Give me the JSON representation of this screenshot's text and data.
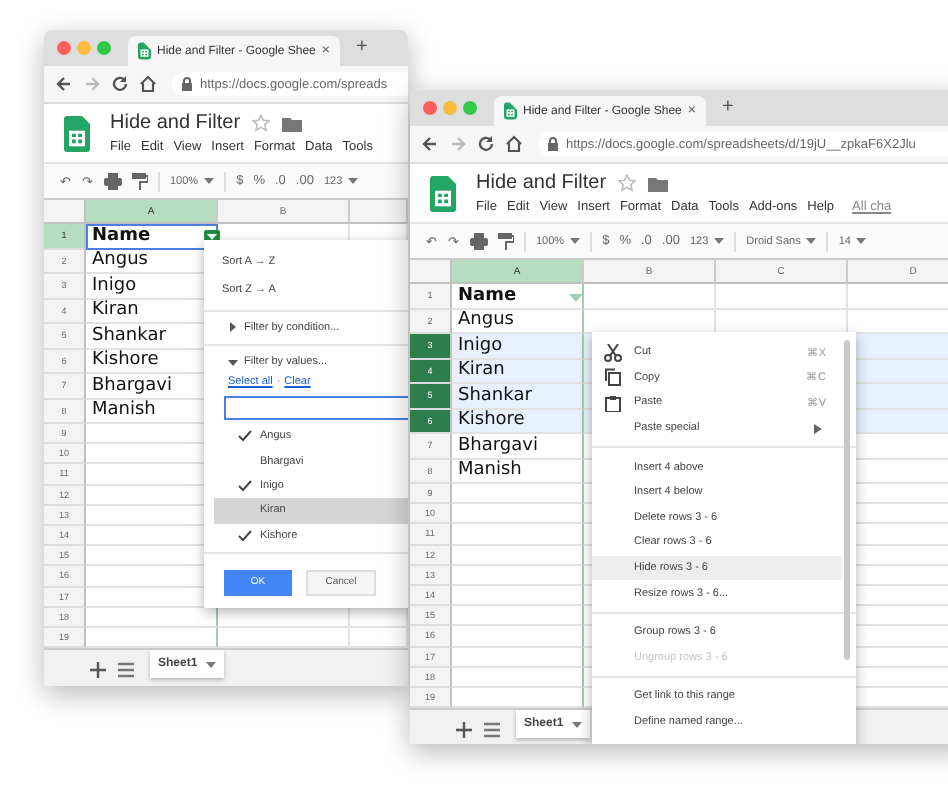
{
  "windows": [
    {
      "browser_tab": "Hide and Filter - Google Shee",
      "tab_close": "×",
      "new_tab": "+",
      "url": "https://docs.google.com/spreads",
      "doc_title": "Hide and Filter",
      "menus": [
        {
          "kind": "menu",
          "label": "File"
        },
        {
          "kind": "menu",
          "label": "Edit"
        },
        {
          "kind": "menu",
          "label": "View"
        },
        {
          "kind": "menu",
          "label": "Insert"
        },
        {
          "kind": "menu",
          "label": "Format"
        },
        {
          "kind": "menu",
          "label": "Data"
        },
        {
          "kind": "menu",
          "label": "Tools"
        }
      ],
      "toolbar": [
        {
          "kind": "text",
          "label": "↶"
        },
        {
          "kind": "text",
          "label": "↷"
        },
        {
          "kind": "print"
        },
        {
          "kind": "paint"
        },
        {
          "kind": "divider"
        },
        {
          "kind": "dropdown",
          "label": "100%"
        },
        {
          "kind": "divider"
        },
        {
          "kind": "text",
          "label": "$"
        },
        {
          "kind": "text",
          "label": "%"
        },
        {
          "kind": "text",
          "label": ".0"
        },
        {
          "kind": "text",
          "label": ".00"
        },
        {
          "kind": "dropdown",
          "label": "123"
        }
      ],
      "columns": [
        {
          "label": "A",
          "selected": true
        },
        {
          "label": "B",
          "selected": false
        }
      ],
      "row_selection": false,
      "filter_open": true,
      "rows": [
        {
          "number": "1",
          "value": "Name",
          "selected": true
        },
        {
          "number": "2",
          "value": "Angus",
          "selected": false
        },
        {
          "number": "3",
          "value": "Inigo",
          "selected": false
        },
        {
          "number": "4",
          "value": "Kiran",
          "selected": false
        },
        {
          "number": "5",
          "value": "Shankar",
          "selected": false
        },
        {
          "number": "6",
          "value": "Kishore",
          "selected": false
        },
        {
          "number": "7",
          "value": "Bhargavi",
          "selected": false
        },
        {
          "number": "8",
          "value": "Manish",
          "selected": false
        },
        {
          "number": "9",
          "selected": false
        },
        {
          "number": "10",
          "selected": false
        },
        {
          "number": "11",
          "selected": false
        },
        {
          "number": "12",
          "selected": false
        },
        {
          "number": "13",
          "selected": false
        },
        {
          "number": "14",
          "selected": false
        },
        {
          "number": "15",
          "selected": false
        },
        {
          "number": "16",
          "selected": false
        },
        {
          "number": "17",
          "selected": false
        },
        {
          "number": "18",
          "selected": false
        },
        {
          "number": "19",
          "selected": false
        }
      ],
      "sheet_tab": "Sheet1",
      "filter_menu": {
        "sort": [
          "Sort A → Z",
          "Sort Z → A"
        ],
        "condition": {
          "label": "Filter by condition...",
          "expanded": false
        },
        "values": {
          "label": "Filter by values...",
          "expanded": true
        },
        "select_all": "Select all",
        "separator": "·",
        "clear": "Clear",
        "items": [
          {
            "label": "Angus",
            "checked": true,
            "selected": false
          },
          {
            "label": "Bhargavi",
            "checked": false,
            "selected": false
          },
          {
            "label": "Inigo",
            "checked": true,
            "selected": false
          },
          {
            "label": "Kiran",
            "checked": false,
            "selected": true
          },
          {
            "label": "Kishore",
            "checked": true,
            "selected": false
          }
        ],
        "ok": "OK",
        "cancel": "Cancel"
      }
    },
    {
      "browser_tab": "Hide and Filter - Google Shee",
      "tab_close": "×",
      "new_tab": "+",
      "url": "https://docs.google.com/spreadsheets/d/19jU__zpkaF6X2Jlu",
      "doc_title": "Hide and Filter",
      "menus": [
        {
          "kind": "menu",
          "label": "File"
        },
        {
          "kind": "menu",
          "label": "Edit"
        },
        {
          "kind": "menu",
          "label": "View"
        },
        {
          "kind": "menu",
          "label": "Insert"
        },
        {
          "kind": "menu",
          "label": "Format"
        },
        {
          "kind": "menu",
          "label": "Data"
        },
        {
          "kind": "menu",
          "label": "Tools"
        },
        {
          "kind": "menu",
          "label": "Add-ons"
        },
        {
          "kind": "menu",
          "label": "Help"
        },
        {
          "kind": "link",
          "label": "All cha"
        }
      ],
      "toolbar": [
        {
          "kind": "text",
          "label": "↶"
        },
        {
          "kind": "text",
          "label": "↷"
        },
        {
          "kind": "print"
        },
        {
          "kind": "paint"
        },
        {
          "kind": "divider"
        },
        {
          "kind": "dropdown",
          "label": "100%"
        },
        {
          "kind": "divider"
        },
        {
          "kind": "text",
          "label": "$"
        },
        {
          "kind": "text",
          "label": "%"
        },
        {
          "kind": "text",
          "label": ".0"
        },
        {
          "kind": "text",
          "label": ".00"
        },
        {
          "kind": "dropdown",
          "label": "123"
        },
        {
          "kind": "divider"
        },
        {
          "kind": "dropdown",
          "label": "Droid Sans"
        },
        {
          "kind": "divider"
        },
        {
          "kind": "dropdown",
          "label": "14"
        }
      ],
      "columns": [
        {
          "label": "A",
          "selected": true
        },
        {
          "label": "B",
          "selected": false
        },
        {
          "label": "C",
          "selected": false
        },
        {
          "label": "D",
          "selected": false
        }
      ],
      "row_selection": true,
      "filter_open": false,
      "rows": [
        {
          "number": "1",
          "value": "Name",
          "selected": false
        },
        {
          "number": "2",
          "value": "Angus",
          "selected": false
        },
        {
          "number": "3",
          "value": "Inigo",
          "selected": true
        },
        {
          "number": "4",
          "value": "Kiran",
          "selected": true
        },
        {
          "number": "5",
          "value": "Shankar",
          "selected": true
        },
        {
          "number": "6",
          "value": "Kishore",
          "selected": true
        },
        {
          "number": "7",
          "value": "Bhargavi",
          "selected": false
        },
        {
          "number": "8",
          "value": "Manish",
          "selected": false
        },
        {
          "number": "9",
          "selected": false
        },
        {
          "number": "10",
          "selected": false
        },
        {
          "number": "11",
          "selected": false
        },
        {
          "number": "12",
          "selected": false
        },
        {
          "number": "13",
          "selected": false
        },
        {
          "number": "14",
          "selected": false
        },
        {
          "number": "15",
          "selected": false
        },
        {
          "number": "16",
          "selected": false
        },
        {
          "number": "17",
          "selected": false
        },
        {
          "number": "18",
          "selected": false
        },
        {
          "number": "19",
          "selected": false
        }
      ],
      "sheet_tab": "Sheet1",
      "context_menu": [
        {
          "kind": "cut",
          "label": "Cut",
          "shortcut": "⌘X",
          "disabled": false,
          "selected": false
        },
        {
          "kind": "copy",
          "label": "Copy",
          "shortcut": "⌘C",
          "disabled": false,
          "selected": false
        },
        {
          "kind": "paste",
          "label": "Paste",
          "shortcut": "⌘V",
          "disabled": false,
          "selected": false
        },
        {
          "kind": "submenu",
          "label": "Paste special",
          "disabled": false,
          "selected": false
        },
        {
          "kind": "separator"
        },
        {
          "kind": "item",
          "label": "Insert 4 above",
          "disabled": false,
          "selected": false
        },
        {
          "kind": "item",
          "label": "Insert 4 below",
          "disabled": false,
          "selected": false
        },
        {
          "kind": "item",
          "label": "Delete rows 3 - 6",
          "disabled": false,
          "selected": false
        },
        {
          "kind": "item",
          "label": "Clear rows 3 - 6",
          "disabled": false,
          "selected": false
        },
        {
          "kind": "item",
          "label": "Hide rows 3 - 6",
          "disabled": false,
          "selected": true
        },
        {
          "kind": "item",
          "label": "Resize rows 3 - 6...",
          "disabled": false,
          "selected": false
        },
        {
          "kind": "separator"
        },
        {
          "kind": "item",
          "label": "Group rows 3 - 6",
          "disabled": false,
          "selected": false
        },
        {
          "kind": "item",
          "label": "Ungroup rows 3 - 6",
          "disabled": true,
          "selected": false
        },
        {
          "kind": "separator"
        },
        {
          "kind": "item",
          "label": "Get link to this range",
          "disabled": false,
          "selected": false
        },
        {
          "kind": "item",
          "label": "Define named range...",
          "disabled": false,
          "selected": false
        }
      ]
    }
  ]
}
